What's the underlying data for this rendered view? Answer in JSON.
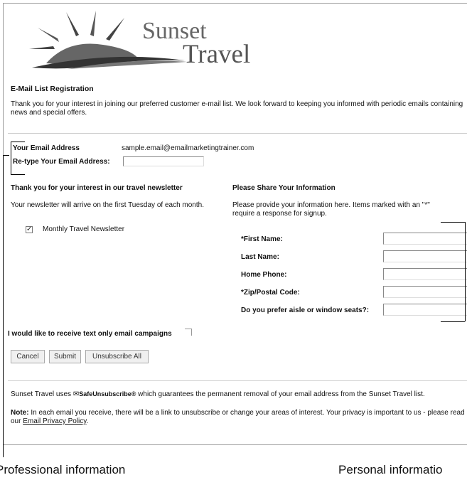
{
  "brand": {
    "line1": "Sunset",
    "line2": "Travel"
  },
  "form": {
    "title": "E-Mail List Registration",
    "intro": "Thank you for your interest in joining our preferred customer e-mail list. We look forward to keeping you informed with periodic emails containing news and special offers.",
    "email_label": "Your Email Address",
    "email_value": "sample.email@emailmarketingtrainer.com",
    "retype_label": "Re-type Your Email Address:",
    "retype_value": ""
  },
  "newsletter": {
    "heading": "Thank you for your interest in our travel newsletter",
    "text": "Your newsletter will arrive on the first Tuesday of each month.",
    "option_label": "Monthly Travel Newsletter",
    "option_checked": true,
    "check_glyph": "✓"
  },
  "share": {
    "heading": "Please Share Your Information",
    "text": "Please provide your information here. Items marked with an \"*\" require a response for signup.",
    "fields": [
      {
        "label": "*First Name:",
        "value": ""
      },
      {
        "label": "Last Name:",
        "value": ""
      },
      {
        "label": "Home Phone:",
        "value": ""
      },
      {
        "label": "*Zip/Postal Code:",
        "value": ""
      },
      {
        "label": "Do you prefer aisle or window seats?:",
        "value": ""
      }
    ]
  },
  "text_only": {
    "label": "I would like to receive text only email campaigns",
    "checked": false
  },
  "buttons": {
    "cancel": "Cancel",
    "submit": "Submit",
    "unsubscribe": "Unsubscribe All"
  },
  "footer": {
    "safe_pre": "Sunset Travel uses",
    "safe_brand": "SafeUnsubscribe®",
    "safe_post": "which guarantees the permanent removal of your email address from the Sunset Travel list.",
    "note_label": "Note:",
    "note_text": "In each email you receive, there will be a link to unsubscribe or change your areas of interest. Your privacy is important to us - please read our",
    "note_link": "Email Privacy Policy",
    "note_end": "."
  },
  "captions": {
    "left": "Professional information",
    "right": "Personal informatio"
  }
}
